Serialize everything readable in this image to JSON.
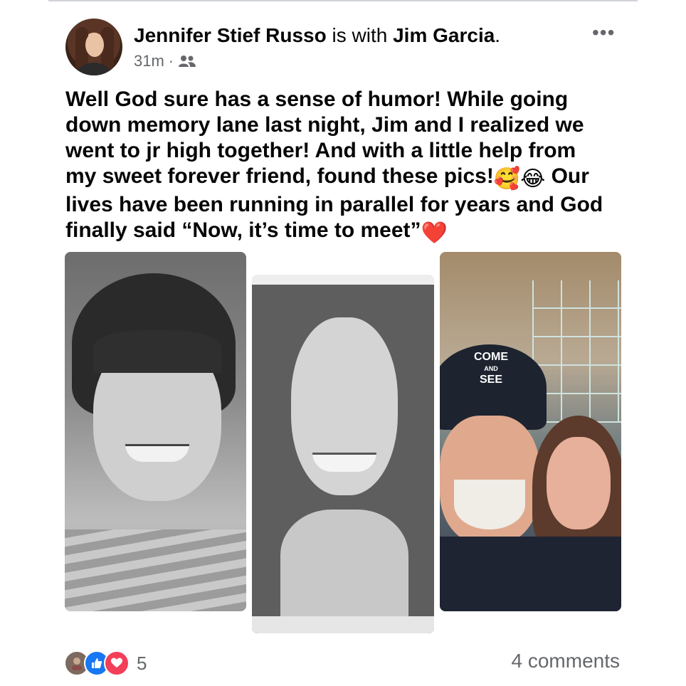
{
  "post": {
    "author": "Jennifer Stief Russo",
    "with_text": "is with",
    "tagged": "Jim Garcia",
    "period": ".",
    "time": "31m",
    "separator": "·",
    "privacy_icon": "friends-icon",
    "more_label": "•••",
    "body_lines": [
      "Well God sure has a sense of humor! While going",
      "down memory lane last night, Jim and I realized we",
      "went to jr high together! And with a little help from",
      "my sweet forever friend, found these pics!",
      "Our",
      "lives have been running in parallel for years and God",
      "finally said “Now, it’s time to meet”"
    ],
    "emojis": [
      "🥰",
      "😂",
      "❤️"
    ],
    "photos": [
      {
        "name": "yearbook-photo-jim"
      },
      {
        "name": "yearbook-photo-jennifer"
      },
      {
        "name": "selfie-photo-couple",
        "cap_text_1": "COME",
        "cap_text_2": "AND",
        "cap_text_3": "SEE"
      }
    ]
  },
  "footer": {
    "reaction_icons": [
      "profile-reaction-icon",
      "like-icon",
      "love-icon"
    ],
    "reaction_count": "5",
    "comments": "4 comments"
  },
  "colors": {
    "secondary_text": "#65676b",
    "like_blue": "#1877f2",
    "love_red": "#f33e58"
  }
}
